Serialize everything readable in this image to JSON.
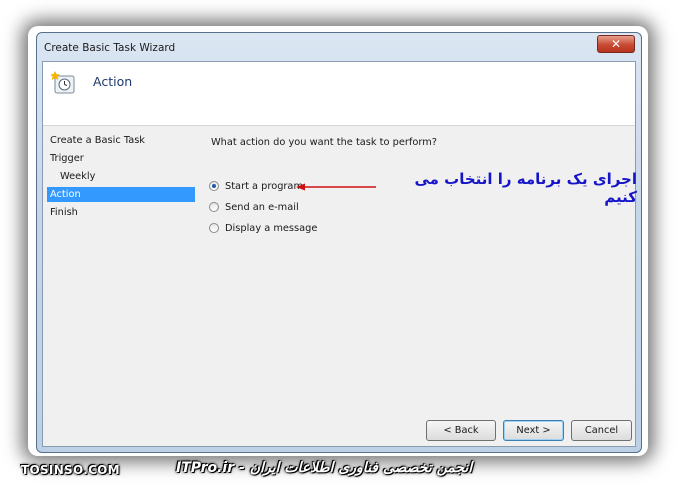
{
  "window": {
    "title": "Create Basic Task Wizard",
    "close_label": "✕"
  },
  "header": {
    "title": "Action",
    "icon": "task-scheduler-icon"
  },
  "nav": {
    "items": [
      {
        "label": "Create a Basic Task",
        "selected": false,
        "sub": false
      },
      {
        "label": "Trigger",
        "selected": false,
        "sub": false
      },
      {
        "label": "Weekly",
        "selected": false,
        "sub": true
      },
      {
        "label": "Action",
        "selected": true,
        "sub": false
      },
      {
        "label": "Finish",
        "selected": false,
        "sub": false
      }
    ]
  },
  "content": {
    "question": "What action do you want the task to perform?",
    "options": [
      {
        "label": "Start a program",
        "checked": true
      },
      {
        "label": "Send an e-mail",
        "checked": false
      },
      {
        "label": "Display a message",
        "checked": false
      }
    ],
    "annotation": "اجرای یک برنامه را انتخاب  می کنیم"
  },
  "buttons": {
    "back": "< Back",
    "next": "Next >",
    "cancel": "Cancel"
  },
  "watermark": {
    "left": "TOSINSO.COM",
    "right": "ITPro.ir - انجمن تخصصی فناوری اطلاعات ایران"
  },
  "colors": {
    "selection": "#3399ff",
    "annotation": "#1616c8",
    "arrow": "#d01010"
  }
}
